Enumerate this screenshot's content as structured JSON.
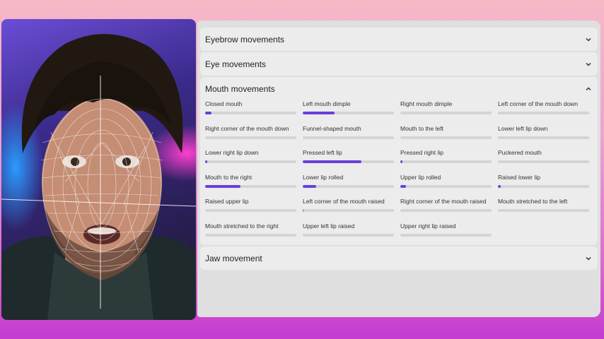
{
  "accent_color": "#6a3fdb",
  "sections": [
    {
      "title": "Eyebrow movements",
      "state": "collapsed"
    },
    {
      "title": "Eye movements",
      "state": "collapsed"
    },
    {
      "title": "Mouth movements",
      "state": "expanded"
    },
    {
      "title": "Jaw movement",
      "state": "collapsed"
    }
  ],
  "mouth_items": [
    {
      "label": "Closed mouth",
      "value": 0.07
    },
    {
      "label": "Left mouth dimple",
      "value": 0.35
    },
    {
      "label": "Right mouth dimple",
      "value": 0.0
    },
    {
      "label": "Left corner of the mouth down",
      "value": 0.0
    },
    {
      "label": "Right corner of the mouth down",
      "value": 0.0
    },
    {
      "label": "Funnel-shaped mouth",
      "value": 0.0
    },
    {
      "label": "Mouth to the left",
      "value": 0.0
    },
    {
      "label": "Lower left lip down",
      "value": 0.0
    },
    {
      "label": "Lower right lip down",
      "value": 0.02
    },
    {
      "label": "Pressed left lip",
      "value": 0.64
    },
    {
      "label": "Pressed right lip",
      "value": 0.02
    },
    {
      "label": "Puckered mouth",
      "value": 0.0
    },
    {
      "label": "Mouth to the right",
      "value": 0.39
    },
    {
      "label": "Lower lip rolled",
      "value": 0.15
    },
    {
      "label": "Upper lip rolled",
      "value": 0.06
    },
    {
      "label": "Raised lower lip",
      "value": 0.03
    },
    {
      "label": "Raised upper lip",
      "value": 0.0
    },
    {
      "label": "Left corner of the mouth raised",
      "value": 0.01
    },
    {
      "label": "Right corner of the mouth raised",
      "value": 0.0
    },
    {
      "label": "Mouth stretched to the left",
      "value": 0.0
    },
    {
      "label": "Mouth stretched to the right",
      "value": 0.0
    },
    {
      "label": "Upper left lip raised",
      "value": 0.0
    },
    {
      "label": "Upper right lip raised",
      "value": 0.0
    }
  ],
  "icons": {
    "collapsed": "chevron-down-icon",
    "expanded": "chevron-up-icon"
  }
}
